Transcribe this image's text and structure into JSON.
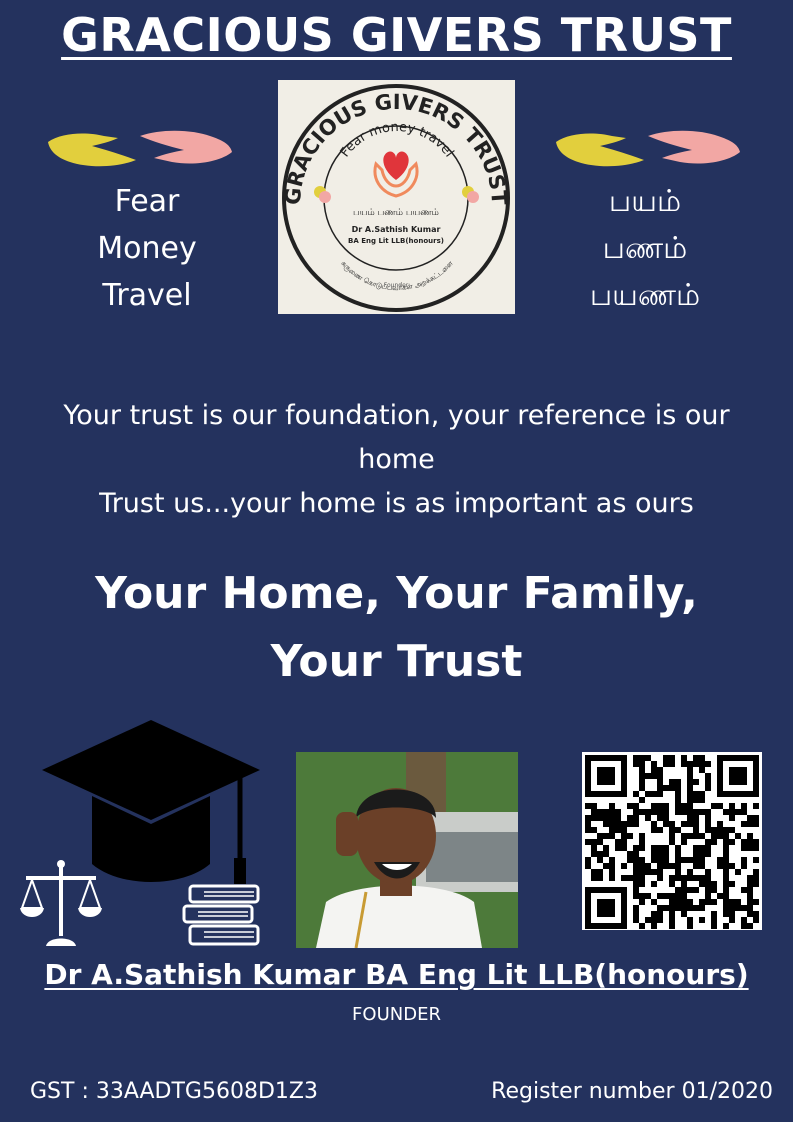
{
  "header": {
    "title": "GRACIOUS GIVERS TRUST"
  },
  "left_panel": {
    "lines": [
      "Fear",
      "Money",
      "Travel"
    ]
  },
  "right_panel": {
    "lines": [
      "பயம்",
      "பணம்",
      "பயணம்"
    ]
  },
  "logo": {
    "arc_top": "GRACIOUS GIVERS TRUST",
    "motto": "Fear money travel",
    "motto_tamil": "பயம் பணம் பயணம்",
    "name": "Dr A.Sathish  Kumar",
    "degree": "BA Eng Lit LLB(honours)",
    "role": "Founder",
    "arc_bottom": "கருணை கொடுப்பவர்கள் அறக்கட்டளை"
  },
  "tagline": {
    "line1": "Your trust is our foundation, your reference is our",
    "line2": "home",
    "line3": "Trust us...your home is as important as ours"
  },
  "headline": {
    "line1": "Your Home, Your Family,",
    "line2": "Your Trust"
  },
  "founder": {
    "name": "Dr A.Sathish  Kumar BA Eng Lit LLB(honours)",
    "role": "FOUNDER"
  },
  "footer": {
    "gst": "GST : 33AADTG5608D1Z3",
    "register": "Register number 01/2020"
  },
  "colors": {
    "background": "#24325e",
    "text": "#ffffff",
    "heart": "#e0353b",
    "hand_yellow": "#e2cf3d",
    "hand_pink": "#f2a7a4"
  }
}
